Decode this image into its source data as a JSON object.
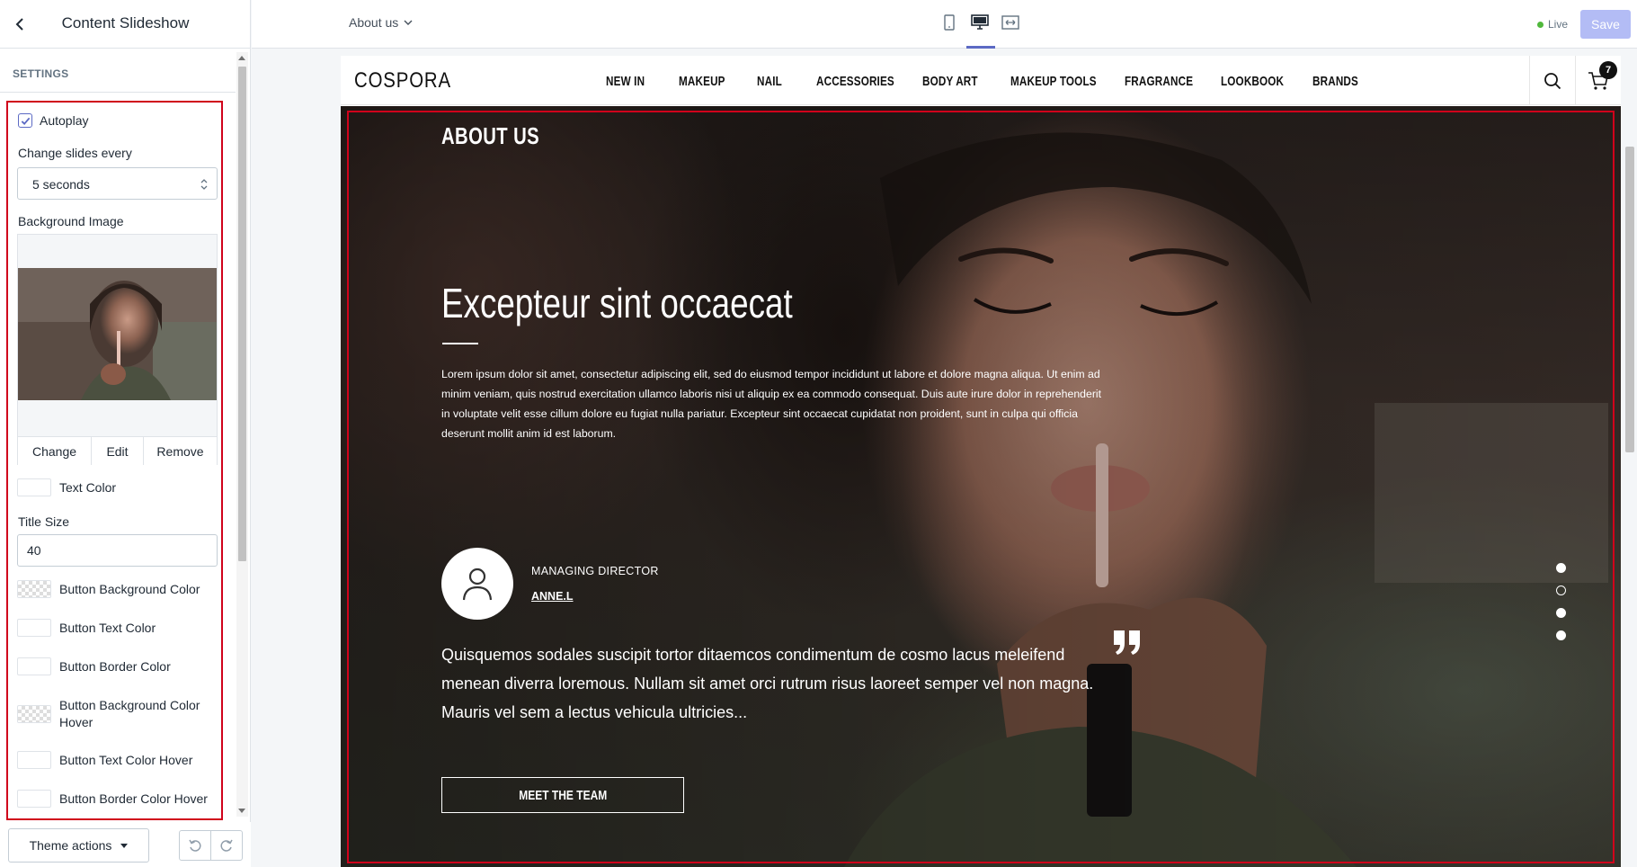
{
  "sidebar": {
    "title": "Content Slideshow",
    "settings_heading": "SETTINGS",
    "autoplay": {
      "label": "Autoplay",
      "checked": true
    },
    "change_slides": {
      "label": "Change slides every",
      "value": "5 seconds"
    },
    "background_image": {
      "label": "Background Image",
      "buttons": {
        "change": "Change",
        "edit": "Edit",
        "remove": "Remove"
      }
    },
    "text_color": {
      "label": "Text Color",
      "value": "#ffffff"
    },
    "title_size": {
      "label": "Title Size",
      "value": "40"
    },
    "colors": {
      "button_bg": "Button Background Color",
      "button_text": "Button Text Color",
      "button_border": "Button Border Color",
      "button_bg_hover": "Button Background Color Hover",
      "button_text_hover": "Button Text Color Hover",
      "button_border_hover": "Button Border Color Hover"
    },
    "footer": {
      "theme_actions": "Theme actions"
    }
  },
  "topbar": {
    "page_select": "About us",
    "status": "Live",
    "save": "Save",
    "views": [
      "mobile-icon",
      "desktop-icon",
      "fullwidth-icon"
    ],
    "active_view": "desktop"
  },
  "store": {
    "logo": "COSPORA",
    "nav": [
      "NEW IN",
      "MAKEUP",
      "NAIL",
      "ACCESSORIES",
      "BODY ART",
      "MAKEUP TOOLS",
      "FRAGRANCE",
      "LOOKBOOK",
      "BRANDS"
    ],
    "cart_count": "7"
  },
  "hero": {
    "section_title": "ABOUT US",
    "title": "Excepteur sint occaecat",
    "body": "Lorem ipsum dolor sit amet, consectetur adipiscing elit, sed do eiusmod tempor incididunt ut labore et dolore magna aliqua. Ut enim ad minim veniam, quis nostrud exercitation ullamco laboris nisi ut aliquip ex ea commodo consequat. Duis aute irure dolor in reprehenderit in voluptate velit esse cillum dolore eu fugiat nulla pariatur. Excepteur sint occaecat cupidatat non proident, sunt in culpa qui officia deserunt mollit anim id est laborum.",
    "person_role": "MANAGING DIRECTOR",
    "person_name": "ANNE.L",
    "quote": "Quisquemos sodales suscipit tortor ditaemcos condimentum de cosmo lacus meleifend menean diverra loremous. Nullam sit amet orci rutrum risus laoreet semper vel non magna. Mauris vel sem a lectus vehicula ultricies...",
    "button": "MEET THE TEAM",
    "slide_count": 4,
    "active_slide": 2
  },
  "colors": {
    "accent": "#5c6ac4",
    "highlight": "#d0021b",
    "live": "#50b83c"
  }
}
